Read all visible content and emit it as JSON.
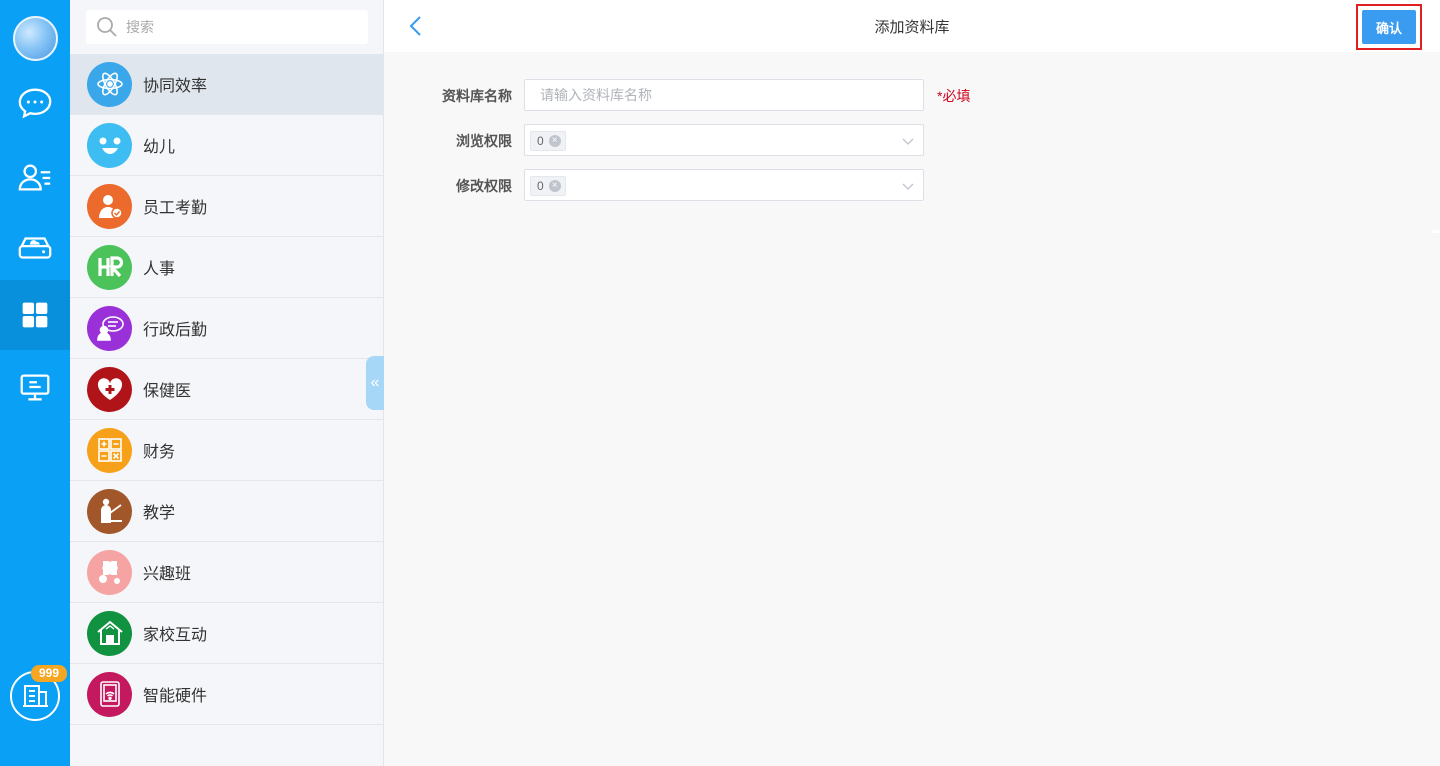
{
  "sidebar_rail": {
    "badge": "999",
    "icons": [
      "avatar",
      "chat-icon",
      "contacts-icon",
      "cloud-drive-icon",
      "apps-grid-icon",
      "monitor-icon",
      "building-icon"
    ]
  },
  "search": {
    "placeholder": "搜索"
  },
  "modules": [
    {
      "label": "协同效率",
      "icon": "atom-icon",
      "color": "#3aa7ea"
    },
    {
      "label": "幼儿",
      "icon": "smiley-icon",
      "color": "#3dbdf1"
    },
    {
      "label": "员工考勤",
      "icon": "employee-icon",
      "color": "#ec6a2c"
    },
    {
      "label": "人事",
      "icon": "hr-icon",
      "color": "#4cc25a"
    },
    {
      "label": "行政后勤",
      "icon": "admin-icon",
      "color": "#9a30d8"
    },
    {
      "label": "保健医",
      "icon": "heart-icon",
      "color": "#b01418"
    },
    {
      "label": "财务",
      "icon": "calculator-icon",
      "color": "#f7a11a"
    },
    {
      "label": "教学",
      "icon": "teacher-icon",
      "color": "#a2572b"
    },
    {
      "label": "兴趣班",
      "icon": "puzzle-icon",
      "color": "#f6a3a3"
    },
    {
      "label": "家校互动",
      "icon": "house-icon",
      "color": "#109241"
    },
    {
      "label": "智能硬件",
      "icon": "smart-device-icon",
      "color": "#c4195f"
    }
  ],
  "header": {
    "title": "添加资料库",
    "confirm_label": "确认"
  },
  "form": {
    "name_label": "资料库名称",
    "name_placeholder": "请输入资料库名称",
    "name_value": "",
    "required_text": "*必填",
    "browse_label": "浏览权限",
    "browse_tag": "0",
    "edit_label": "修改权限",
    "edit_tag": "0"
  },
  "colors": {
    "rail": "#0aa0f5",
    "accent": "#3a9cf0",
    "required": "#d0021b",
    "highlight_border": "#e02020"
  }
}
